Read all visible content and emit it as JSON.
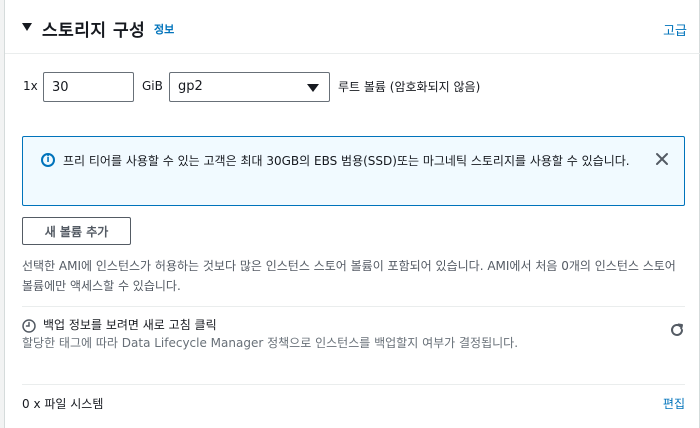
{
  "header": {
    "title": "스토리지 구성",
    "info_link": "정보",
    "advanced_link": "고급"
  },
  "volume": {
    "quantity": "1x",
    "size_value": "30",
    "size_unit": "GiB",
    "type_selected": "gp2",
    "root_label": "루트 볼륨  (암호화되지 않음)"
  },
  "alert": {
    "icon": "info-icon",
    "text": "프리 티어를 사용할 수 있는 고객은 최대 30GB의 EBS 범용(SSD)또는 마그네틱 스토리지를 사용할 수 있습니다."
  },
  "actions": {
    "add_volume": "새 볼륨 추가"
  },
  "ami_note": "선택한 AMI에 인스턴스가 허용하는 것보다 많은 인스턴스 스토어 볼륨이 포함되어 있습니다. AMI에서 처음 0개의 인스턴스 스토어 볼륨에만 액세스할 수 있습니다.",
  "backup": {
    "title": "백업 정보를 보려면 새로 고침 클릭",
    "description": "할당한 태그에 따라 Data Lifecycle Manager 정책으로 인스턴스를 백업할지 여부가 결정됩니다."
  },
  "filesystems": {
    "label": "0 x 파일 시스템",
    "edit_link": "편집"
  },
  "colors": {
    "link": "#0073bb",
    "alert_bg": "#f1faff",
    "alert_border": "#0073bb"
  }
}
